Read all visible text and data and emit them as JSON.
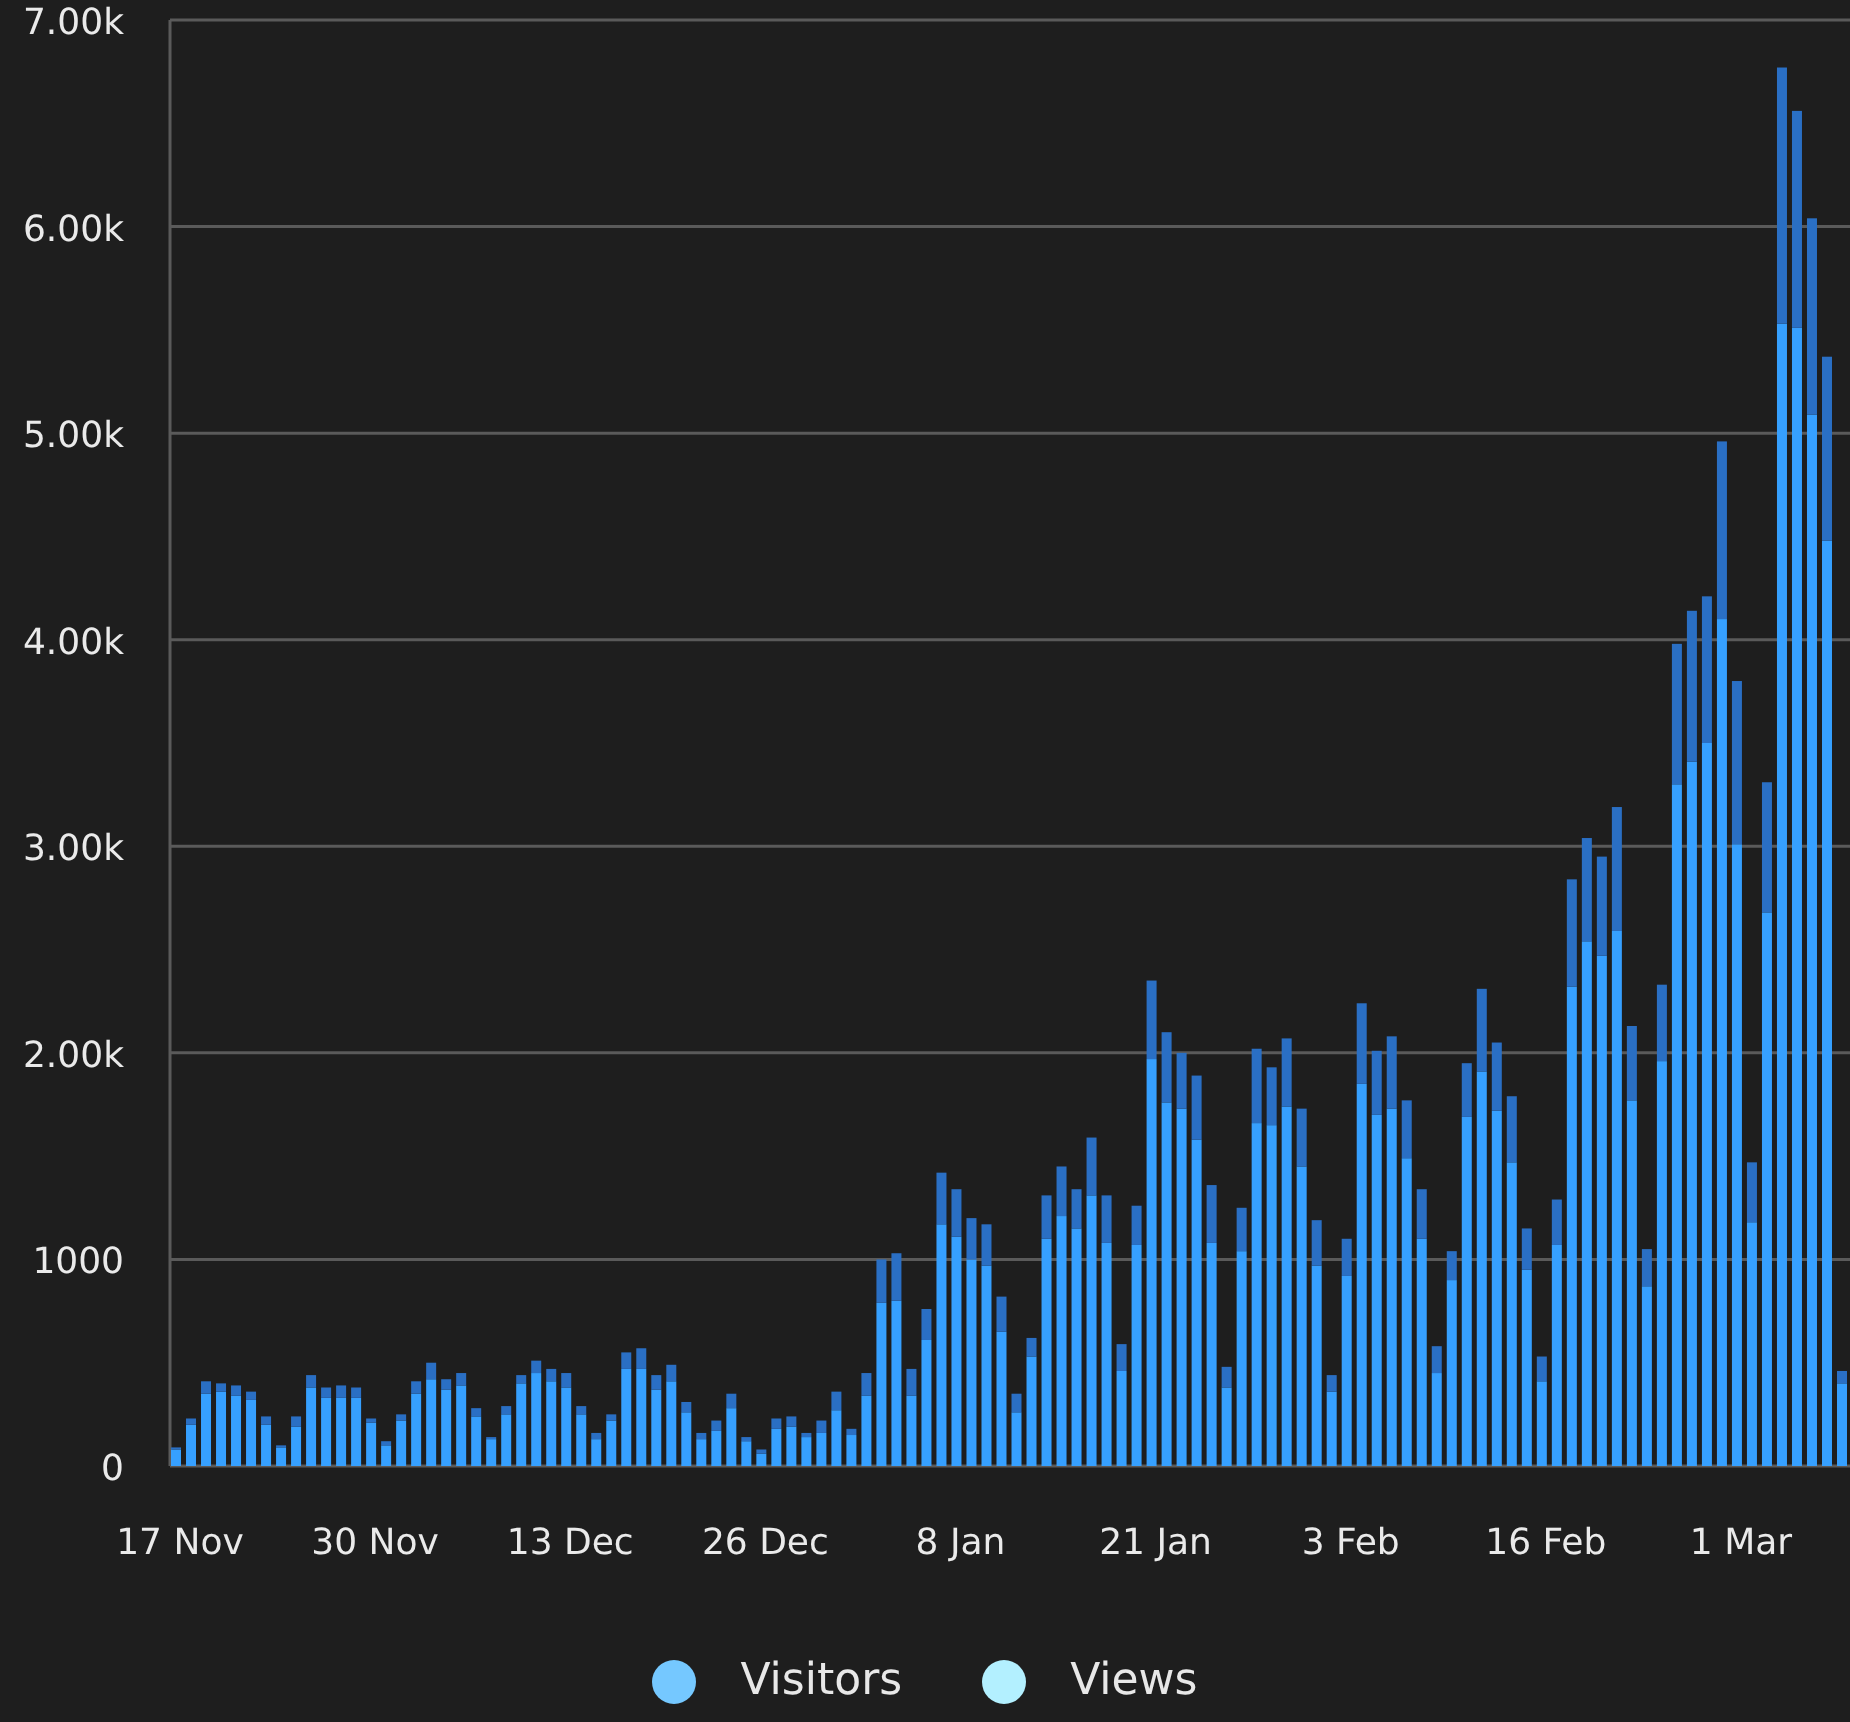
{
  "chart": {
    "chart_data": {
      "type": "bar",
      "stacked": true,
      "grid": true,
      "ylim": [
        0,
        7000
      ],
      "yticks": [
        {
          "value": 0,
          "label": "0"
        },
        {
          "value": 1000,
          "label": "1000"
        },
        {
          "value": 2000,
          "label": "2.00k"
        },
        {
          "value": 3000,
          "label": "3.00k"
        },
        {
          "value": 4000,
          "label": "4.00k"
        },
        {
          "value": 5000,
          "label": "5.00k"
        },
        {
          "value": 6000,
          "label": "6.00k"
        },
        {
          "value": 7000,
          "label": "7.00k"
        }
      ],
      "categories": [
        "17 Nov",
        null,
        null,
        null,
        null,
        null,
        null,
        null,
        null,
        null,
        null,
        null,
        null,
        "30 Nov",
        null,
        null,
        null,
        null,
        null,
        null,
        null,
        null,
        null,
        null,
        null,
        null,
        "13 Dec",
        null,
        null,
        null,
        null,
        null,
        null,
        null,
        null,
        null,
        null,
        null,
        null,
        "26 Dec",
        null,
        null,
        null,
        null,
        null,
        null,
        null,
        null,
        null,
        null,
        null,
        null,
        "8 Jan",
        null,
        null,
        null,
        null,
        null,
        null,
        null,
        null,
        null,
        null,
        null,
        null,
        "21 Jan",
        null,
        null,
        null,
        null,
        null,
        null,
        null,
        null,
        null,
        null,
        null,
        null,
        "3 Feb",
        null,
        null,
        null,
        null,
        null,
        null,
        null,
        null,
        null,
        null,
        null,
        null,
        "16 Feb",
        null,
        null,
        null,
        null,
        null,
        null,
        null,
        null,
        null,
        null,
        null,
        null,
        "1 Mar",
        null,
        null,
        null,
        null,
        null,
        null,
        null
      ],
      "series": [
        {
          "name": "Visitors",
          "color": "#36a0ff",
          "values": [
            80,
            200,
            350,
            360,
            340,
            320,
            200,
            90,
            190,
            380,
            330,
            330,
            330,
            210,
            100,
            220,
            350,
            420,
            370,
            390,
            240,
            130,
            250,
            400,
            450,
            410,
            380,
            250,
            130,
            220,
            470,
            470,
            370,
            410,
            260,
            130,
            170,
            280,
            120,
            60,
            180,
            190,
            140,
            160,
            270,
            150,
            340,
            790,
            800,
            340,
            610,
            1170,
            1110,
            1000,
            970,
            650,
            260,
            530,
            1100,
            1210,
            1150,
            1310,
            1080,
            460,
            1070,
            1970,
            1760,
            1730,
            1580,
            1080,
            380,
            1040,
            1660,
            1650,
            1740,
            1450,
            970,
            360,
            920,
            1850,
            1700,
            1730,
            1490,
            1100,
            450,
            900,
            1690,
            1910,
            1720,
            1470,
            950,
            410,
            1070,
            2320,
            2540,
            2470,
            2590,
            1770,
            870,
            1960,
            3300,
            3410,
            3500,
            4100,
            3010,
            1180,
            2680,
            5530,
            5510,
            5090,
            4480,
            400
          ]
        },
        {
          "name": "Views",
          "color": "#2a6fc4",
          "values": [
            10,
            30,
            60,
            40,
            50,
            40,
            40,
            10,
            50,
            60,
            50,
            60,
            50,
            20,
            20,
            30,
            60,
            80,
            50,
            60,
            40,
            10,
            40,
            40,
            60,
            60,
            70,
            40,
            30,
            30,
            80,
            100,
            70,
            80,
            50,
            30,
            50,
            70,
            20,
            20,
            50,
            50,
            20,
            60,
            90,
            30,
            110,
            210,
            230,
            130,
            150,
            250,
            230,
            200,
            200,
            170,
            90,
            90,
            210,
            240,
            190,
            280,
            230,
            130,
            190,
            380,
            340,
            270,
            310,
            280,
            100,
            210,
            360,
            280,
            330,
            280,
            220,
            80,
            180,
            390,
            310,
            350,
            280,
            240,
            130,
            140,
            260,
            400,
            330,
            320,
            200,
            120,
            220,
            520,
            500,
            480,
            600,
            360,
            180,
            370,
            680,
            730,
            710,
            860,
            790,
            290,
            630,
            1240,
            1050,
            950,
            890,
            60
          ]
        }
      ]
    }
  },
  "legend": [
    {
      "color": "#75c8ff"
    },
    {
      "color": "#b3f0ff"
    }
  ]
}
